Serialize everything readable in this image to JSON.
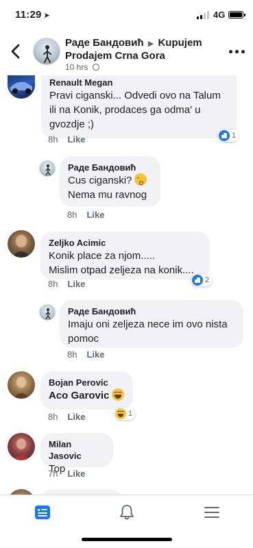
{
  "status": {
    "time": "11:29",
    "network": "4G"
  },
  "header": {
    "author": "Раде Бандовић",
    "group": "Kupujem Prodajem Crna Gora",
    "time": "10 hrs"
  },
  "comments": [
    {
      "name": "Renault Megan",
      "text": "Pravi ciganski... Odvedi ovo na Talum ili na Konik, prodaces ga odma' u gvozdje ;)",
      "time": "8h",
      "like": "Like",
      "reaction_count": "1"
    },
    {
      "name": "Раде Бандовић",
      "text1": "Cus ciganski?",
      "text2": "Nema mu ravnog",
      "time": "8h",
      "like": "Like"
    },
    {
      "name": "Zeljko Acimic",
      "text1": "Konik place za njom.....",
      "text2": "Mislim otpad zeljeza na konik....",
      "time": "8h",
      "like": "Like",
      "reaction_count": "2"
    },
    {
      "name": "Раде Бандовић",
      "text": "Imaju oni zeljeza nece im ovo nista pomoc",
      "time": "8h",
      "like": "Like"
    },
    {
      "name": "Bojan Perovic",
      "text": "Aco Garovic",
      "time": "8h",
      "like": "Like",
      "reaction_count": "1"
    },
    {
      "name": "Milan Jasovic",
      "text": "Top",
      "time": "7h",
      "like": "Like"
    }
  ],
  "icons": {
    "back": "chevron-left-icon",
    "more": "more-horizontal-icon",
    "nav": [
      "news-feed-icon",
      "notifications-bell-icon",
      "menu-icon"
    ]
  },
  "colors": {
    "accent": "#1877f2",
    "bubble": "#f0f2f5",
    "meta": "#606770"
  }
}
